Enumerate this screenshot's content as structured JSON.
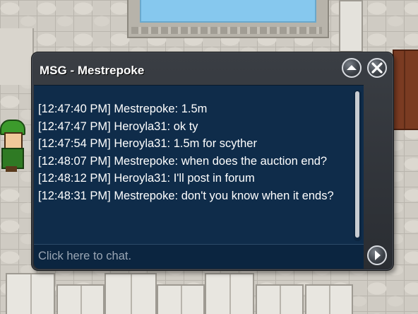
{
  "chat_window": {
    "title": "MSG - Mestrepoke",
    "collapse_icon": "chevron-up-icon",
    "close_icon": "close-icon",
    "messages": [
      "[12:47:40 PM] Mestrepoke: 1.5m",
      "[12:47:47 PM] Heroyla31: ok ty",
      "[12:47:54 PM] Heroyla31: 1.5m for scyther",
      "[12:48:07 PM] Mestrepoke: when does the auction end?",
      "[12:48:12 PM] Heroyla31: I'll post in forum",
      "[12:48:31 PM] Mestrepoke: don't you know when it ends?"
    ],
    "input": {
      "placeholder": "Click here to chat.",
      "value": ""
    },
    "send_icon": "arrow-right-icon",
    "scroll_position": 1.0
  },
  "colors": {
    "message_background": "#0f2c4a",
    "frame": "#2e3237",
    "text": "#ffffff",
    "placeholder": "#9aa6b4"
  }
}
